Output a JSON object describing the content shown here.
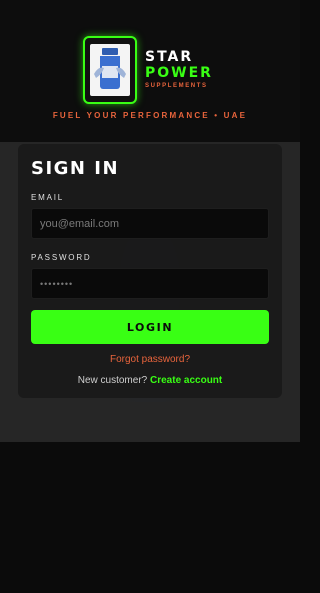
{
  "brand": {
    "line1": "STAR",
    "line2": "POWER",
    "line3": "SUPPLEMENTS",
    "tagline": "FUEL YOUR PERFORMANCE • UAE",
    "logo_icon": "supplement-jar-logo"
  },
  "signin": {
    "title": "SIGN IN",
    "email_label": "EMAIL",
    "email_placeholder": "you@email.com",
    "password_label": "PASSWORD",
    "password_placeholder": "••••••••",
    "login_label": "LOGIN",
    "forgot_label": "Forgot password?",
    "new_customer_text": "New customer?",
    "create_account_label": "Create account"
  },
  "colors": {
    "accent_green": "#39ff14",
    "accent_orange": "#e8643c",
    "background": "#0b0b0b",
    "card": "#1a1a1a"
  }
}
